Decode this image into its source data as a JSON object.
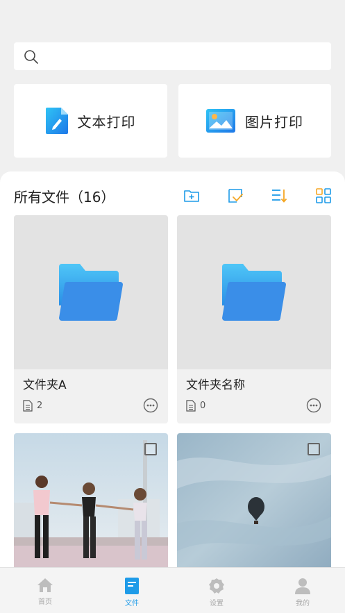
{
  "search": {
    "placeholder": ""
  },
  "print_options": [
    {
      "label": "文本打印",
      "icon": "text-document-icon"
    },
    {
      "label": "图片打印",
      "icon": "image-icon"
    }
  ],
  "files": {
    "title": "所有文件（16）",
    "toolbar": [
      "new-folder-icon",
      "select-icon",
      "sort-icon",
      "grid-view-icon"
    ]
  },
  "folders": [
    {
      "name": "文件夹A",
      "count": "2"
    },
    {
      "name": "文件夹名称",
      "count": "0"
    }
  ],
  "photos": [
    {
      "subject": "photo-women-holding-hands"
    },
    {
      "subject": "photo-hot-air-balloon"
    }
  ],
  "tabs": [
    {
      "label": "首页",
      "icon": "home-icon",
      "active": false
    },
    {
      "label": "文件",
      "icon": "file-icon",
      "active": true
    },
    {
      "label": "设置",
      "icon": "settings-icon",
      "active": false
    },
    {
      "label": "我的",
      "icon": "profile-icon",
      "active": false
    }
  ],
  "colors": {
    "accent": "#1e9be8",
    "folder": "#3a8ee8",
    "tool_orange": "#f5a623"
  }
}
